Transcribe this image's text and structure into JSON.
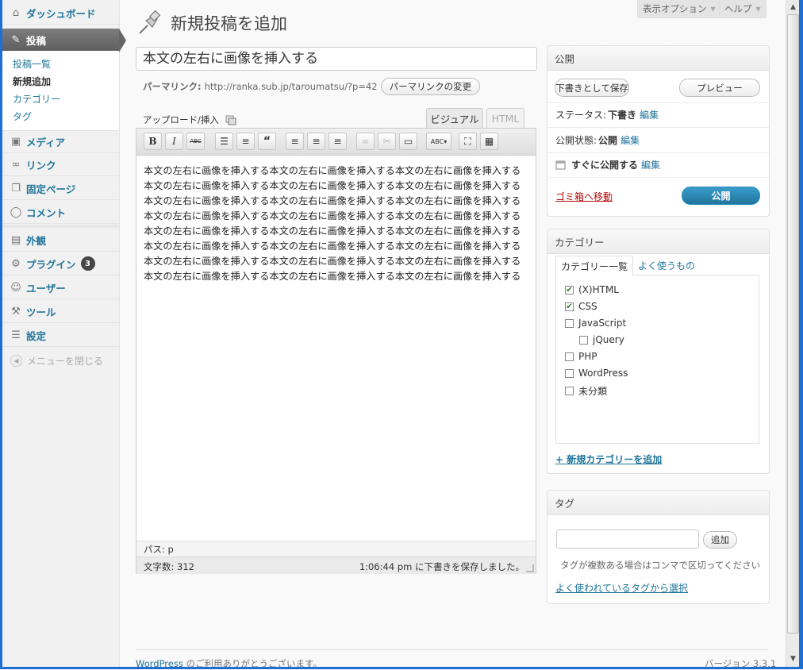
{
  "sidebar": {
    "dashboard": "ダッシュボード",
    "posts": "投稿",
    "sub": [
      "投稿一覧",
      "新規追加",
      "カテゴリー",
      "タグ"
    ],
    "media": "メディア",
    "links": "リンク",
    "pages": "固定ページ",
    "comments": "コメント",
    "appearance": "外観",
    "plugins": "プラグイン",
    "plugins_badge": "3",
    "users": "ユーザー",
    "tools": "ツール",
    "settings": "設定",
    "collapse": "メニューを閉じる"
  },
  "header": {
    "screen_options": "表示オプション",
    "help": "ヘルプ",
    "title": "新規投稿を追加"
  },
  "editor": {
    "post_title": "本文の左右に画像を挿入する",
    "permalink_label": "パーマリンク:",
    "permalink_url": "http://ranka.sub.jp/taroumatsu/?p=42",
    "permalink_button": "パーマリンクの変更",
    "upload_label": "アップロード/挿入",
    "tab_visual": "ビジュアル",
    "tab_html": "HTML",
    "content": "本文の左右に画像を挿入する本文の左右に画像を挿入する本文の左右に画像を挿入する本文の左右に画像を挿入する本文の左右に画像を挿入する本文の左右に画像を挿入する本文の左右に画像を挿入する本文の左右に画像を挿入する本文の左右に画像を挿入する本文の左右に画像を挿入する本文の左右に画像を挿入する本文の左右に画像を挿入する本文の左右に画像を挿入する本文の左右に画像を挿入する本文の左右に画像を挿入する本文の左右に画像を挿入する本文の左右に画像を挿入する本文の左右に画像を挿入する本文の左右に画像を挿入する本文の左右に画像を挿入する本文の左右に画像を挿入する本文の左右に画像を挿入する本文の左右に画像を挿入する本文の左右に画像を挿入する",
    "path": "パス: p",
    "word_count": "文字数: 312",
    "saved_msg": "1:06:44 pm に下書きを保存しました。"
  },
  "publish": {
    "title": "公開",
    "save_draft": "下書きとして保存",
    "preview": "プレビュー",
    "status_label": "ステータス:",
    "status_value": "下書き",
    "visibility_label": "公開状態:",
    "visibility_value": "公開",
    "schedule": "すぐに公開する",
    "edit": "編集",
    "trash": "ゴミ箱へ移動",
    "publish_button": "公開"
  },
  "categories": {
    "title": "カテゴリー",
    "tab_all": "カテゴリー一覧",
    "tab_popular": "よく使うもの",
    "items": [
      {
        "label": "(X)HTML",
        "checked": true
      },
      {
        "label": "CSS",
        "checked": true
      },
      {
        "label": "JavaScript",
        "checked": false
      },
      {
        "label": "jQuery",
        "checked": false
      },
      {
        "label": "PHP",
        "checked": false
      },
      {
        "label": "WordPress",
        "checked": false
      },
      {
        "label": "未分類",
        "checked": false
      }
    ],
    "add_new": "+ 新規カテゴリーを追加"
  },
  "tags": {
    "title": "タグ",
    "add_button": "追加",
    "hint": "タグが複数ある場合はコンマで区切ってください",
    "popular_link": "よく使われているタグから選択"
  },
  "footer": {
    "thanks_link": "WordPress",
    "thanks_text": " のご利用ありがとうございます。",
    "version": "バージョン 3.3.1"
  },
  "colors": {
    "link": "#21759b",
    "publish_button": "#21759b",
    "trash": "#bc0b0b",
    "active_menu": "#6d6d6d"
  },
  "icons": {
    "title": "pushpin-icon",
    "upload": "media-upload-icon",
    "schedule": "calendar-icon"
  }
}
